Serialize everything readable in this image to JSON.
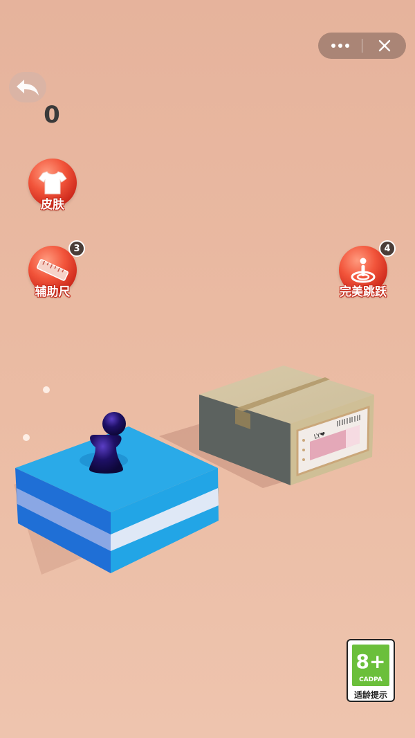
{
  "capsule": {
    "more_icon": "more-dots-icon",
    "close_icon": "close-icon"
  },
  "back": {
    "icon": "back-arrow-icon"
  },
  "score": {
    "value": "0"
  },
  "powerups": {
    "skin": {
      "label": "皮肤",
      "icon": "tshirt-icon"
    },
    "ruler": {
      "label": "辅助尺",
      "icon": "ruler-icon",
      "count": "3"
    },
    "perfect_jump": {
      "label": "完美跳跃",
      "icon": "target-person-icon",
      "count": "4"
    }
  },
  "box": {
    "label_text": "LY❤"
  },
  "age_rating": {
    "rating": "8+",
    "org": "CADPA",
    "tip": "适龄提示"
  },
  "colors": {
    "background": "#e6b39c",
    "platform_blue": "#2fa8e6",
    "powerup_red": "#f2553b",
    "player": "#1c1160"
  }
}
